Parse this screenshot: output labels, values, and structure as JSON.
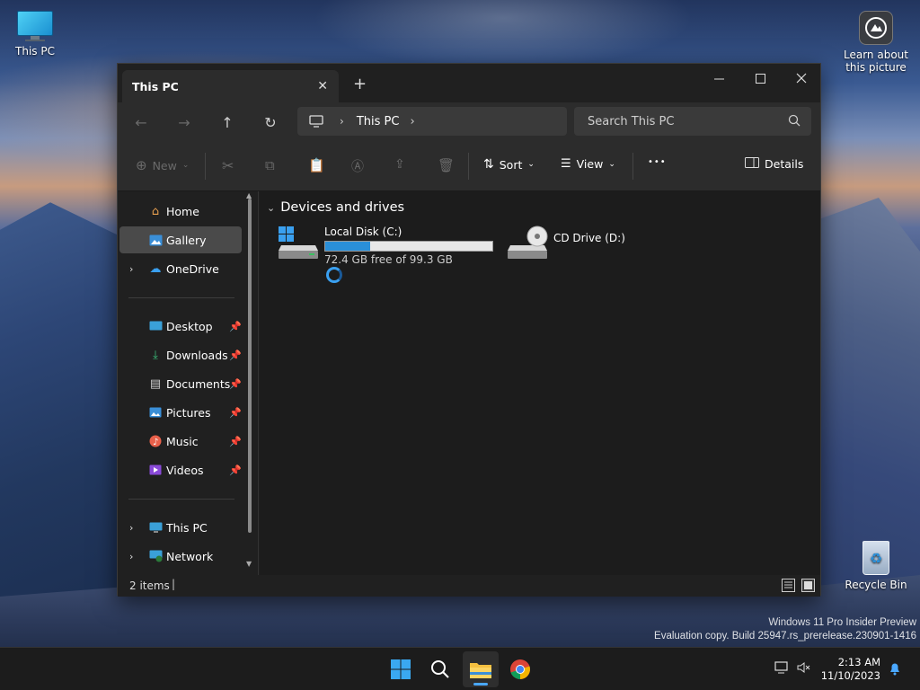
{
  "desktop": {
    "icons": {
      "this_pc": "This PC",
      "learn_line1": "Learn about",
      "learn_line2": "this picture",
      "recycle_bin": "Recycle Bin"
    },
    "watermark": {
      "line1": "Windows 11 Pro Insider Preview",
      "line2": "Evaluation copy. Build 25947.rs_prerelease.230901-1416"
    }
  },
  "window": {
    "tab_title": "This PC",
    "new_tab": "+",
    "nav": {
      "back_icon": "←",
      "forward_icon": "→",
      "up_icon": "↑",
      "refresh_icon": "↻"
    },
    "address": {
      "crumb": "This PC"
    },
    "search": {
      "placeholder": "Search This PC"
    },
    "toolbar": {
      "new_label": "New",
      "sort_label": "Sort",
      "view_label": "View",
      "more_label": "•••",
      "details_label": "Details"
    },
    "sidebar": {
      "home": "Home",
      "gallery": "Gallery",
      "onedrive": "OneDrive",
      "desktop": "Desktop",
      "downloads": "Downloads",
      "documents": "Documents",
      "pictures": "Pictures",
      "music": "Music",
      "videos": "Videos",
      "this_pc": "This PC",
      "network": "Network"
    },
    "content": {
      "group_header": "Devices and drives",
      "drives": [
        {
          "name": "Local Disk (C:)",
          "free_text": "72.4 GB free of 99.3 GB",
          "used_fraction": 0.271
        },
        {
          "name": "CD Drive (D:)"
        }
      ]
    },
    "status": {
      "item_count": "2 items"
    }
  },
  "taskbar": {
    "time": "2:13 AM",
    "date": "11/10/2023"
  },
  "colors": {
    "accent": "#2a8fd8",
    "window_bg": "#202020",
    "content_bg": "#1c1c1c"
  }
}
